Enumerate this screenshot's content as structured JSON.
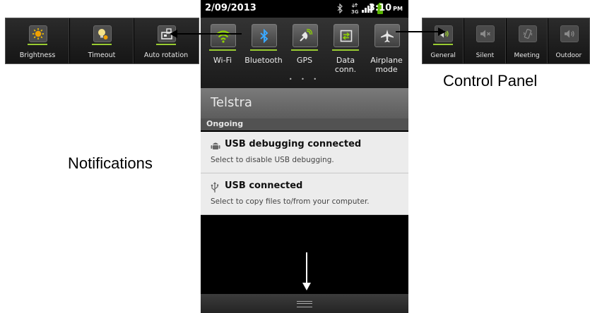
{
  "left_strip": {
    "items": [
      {
        "label": "Brightness",
        "icon": "brightness-icon"
      },
      {
        "label": "Timeout",
        "icon": "timeout-icon"
      },
      {
        "label": "Auto rotation",
        "icon": "auto-rotation-icon"
      }
    ]
  },
  "right_strip": {
    "items": [
      {
        "label": "General",
        "icon": "volume-general-icon"
      },
      {
        "label": "Silent",
        "icon": "volume-silent-icon"
      },
      {
        "label": "Meeting",
        "icon": "vibrate-meeting-icon"
      },
      {
        "label": "Outdoor",
        "icon": "volume-outdoor-icon"
      }
    ]
  },
  "status_bar": {
    "date": "2/09/2013",
    "time": "3:10",
    "ampm": "PM",
    "network": "3G"
  },
  "quick_panel": {
    "toggles": [
      {
        "label": "Wi-Fi",
        "icon": "wifi-icon",
        "active": true
      },
      {
        "label": "Bluetooth",
        "icon": "bluetooth-icon",
        "active": true
      },
      {
        "label": "GPS",
        "icon": "gps-icon",
        "active": true
      },
      {
        "label": "Data\nconn.",
        "icon": "data-connection-icon",
        "active": true
      },
      {
        "label": "Airplane\nmode",
        "icon": "airplane-icon",
        "active": false
      }
    ],
    "page_dots": "• • •"
  },
  "carrier": "Telstra",
  "ongoing": {
    "header": "Ongoing",
    "notifications": [
      {
        "title": "USB debugging connected",
        "description": "Select to disable USB debugging.",
        "icon": "android-debug-icon"
      },
      {
        "title": "USB connected",
        "description": "Select to copy files to/from your computer.",
        "icon": "usb-icon"
      }
    ]
  },
  "captions": {
    "control_panel": "Control Panel",
    "notifications": "Notifications"
  },
  "colors": {
    "accent_green": "#9acd32",
    "panel_dark": "#1b1b1b",
    "notification_bg": "#ececec",
    "carrier_bg": "#6a6a6a"
  }
}
